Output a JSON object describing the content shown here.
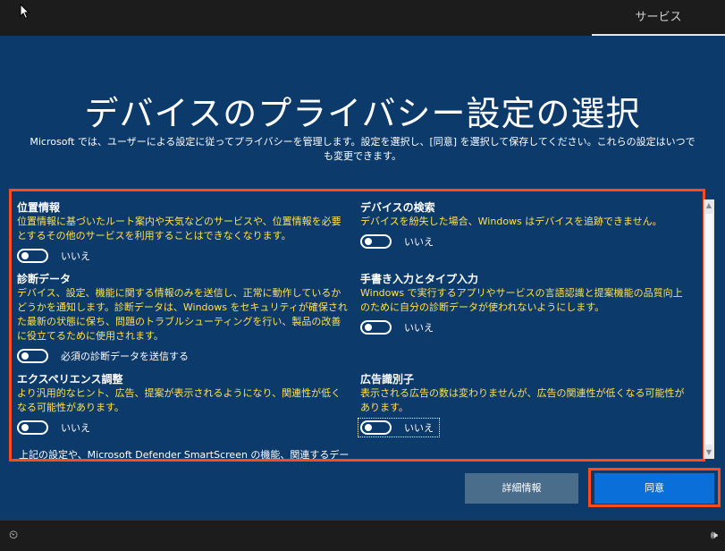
{
  "header": {
    "service_tab": "サービス"
  },
  "title": "デバイスのプライバシー設定の選択",
  "subtitle": "Microsoft では、ユーザーによる設定に従ってプライバシーを管理します。設定を選択し、[同意] を選択して保存してください。これらの設定はいつでも変更できます。",
  "settings": [
    {
      "title": "位置情報",
      "desc": "位置情報に基づいたルート案内や天気などのサービスや、位置情報を必要とするその他のサービスを利用することはできなくなります。",
      "toggle": "いいえ"
    },
    {
      "title": "デバイスの検索",
      "desc": "デバイスを紛失した場合、Windows はデバイスを追跡できません。",
      "toggle": "いいえ"
    },
    {
      "title": "診断データ",
      "desc": "デバイス、設定、機能に関する情報のみを送信し、正常に動作しているかどうかを通知します。診断データは、Windows をセキュリティが確保された最新の状態に保ち、問題のトラブルシューティングを行い、製品の改善に役立てるために使用されます。",
      "toggle": "必須の診断データを送信する"
    },
    {
      "title": "手書き入力とタイプ入力",
      "desc": "Windows で実行するアプリやサービスの言語認識と提案機能の品質向上のために自分の診断データが使われないようにします。",
      "toggle": "いいえ"
    },
    {
      "title": "エクスペリエンス調整",
      "desc": "より汎用的なヒント、広告、提案が表示されるようになり、関連性が低くなる可能性があります。",
      "toggle": "いいえ"
    },
    {
      "title": "広告識別子",
      "desc": "表示される広告の数は変わりませんが、広告の関連性が低くなる可能性があります。",
      "toggle": "いいえ"
    }
  ],
  "footer_text": "上記の設定や、Microsoft Defender SmartScreen の機能、関連するデー",
  "buttons": {
    "details": "詳細情報",
    "agree": "同意"
  },
  "colors": {
    "background": "#0c3a6b",
    "highlight": "#ff4a1c",
    "description": "#ffe14d",
    "primary_button": "#0a6fd8"
  },
  "icons": {
    "cursor": "mouse-pointer-icon",
    "ease_of_access": "ease-of-access-icon",
    "volume": "volume-icon"
  }
}
